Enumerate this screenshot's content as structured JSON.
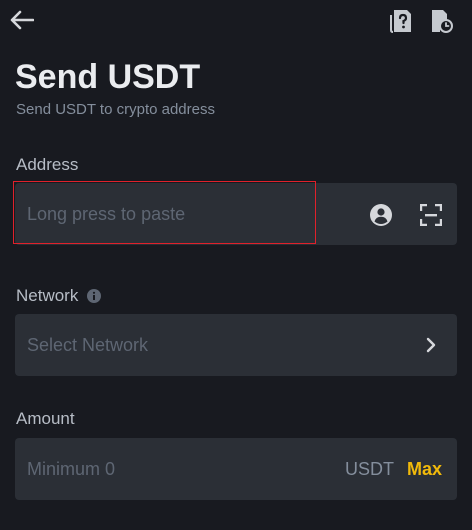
{
  "header": {
    "back_icon": "arrow-left-icon",
    "help_icon": "help-document-icon",
    "history_icon": "history-document-icon",
    "title": "Send USDT",
    "subtitle": "Send USDT to crypto address"
  },
  "form": {
    "address": {
      "label": "Address",
      "value": "",
      "placeholder": "Long press to paste",
      "contact_icon": "address-book-icon",
      "scan_icon": "scan-icon"
    },
    "network": {
      "label": "Network",
      "info_icon": "info-icon",
      "placeholder": "Select Network",
      "chevron_icon": "chevron-right-icon"
    },
    "amount": {
      "label": "Amount",
      "value": "",
      "placeholder": "Minimum 0",
      "unit": "USDT",
      "max_label": "Max"
    }
  },
  "colors": {
    "background": "#181a20",
    "field_background": "#2b2f36",
    "accent": "#f0b90b",
    "highlight": "#e0212b"
  }
}
